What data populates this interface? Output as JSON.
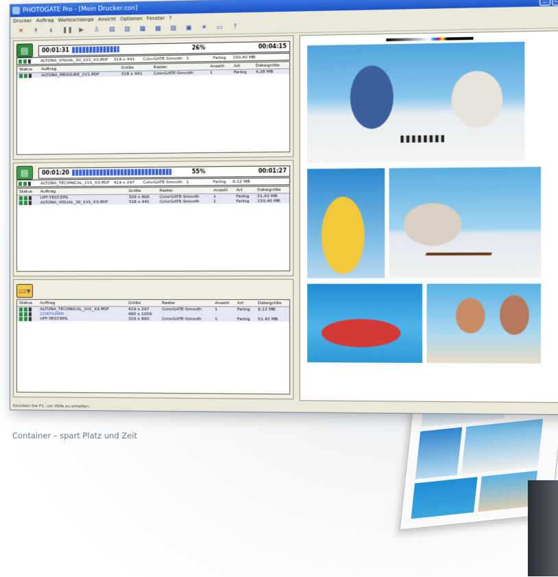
{
  "window": {
    "title": "PHOTOGATE Pro - [Mein Drucker.con]",
    "menu": [
      "Drucker",
      "Auftrag",
      "Warteschlange",
      "Ansicht",
      "Optionen",
      "Fenster",
      "?"
    ]
  },
  "toolbar": {
    "icons": [
      "delete-icon",
      "move-up-icon",
      "move-down-icon",
      "pause-icon",
      "play-icon",
      "print-icon",
      "job-settings-icon",
      "queue-icon",
      "copy-icon",
      "layout-icon",
      "container-icon",
      "preview-icon",
      "crop-icon",
      "save-icon",
      "help-icon"
    ]
  },
  "active_queue": {
    "elapsed": "00:01:31",
    "percent": "26%",
    "progress": 0.26,
    "remaining": "00:04:15",
    "current_job": {
      "name": "ALTONA_VISUAL_30_1V1_X3.PDF",
      "size": "318 x 441",
      "raster": "ColorGATE-Smooth",
      "count": "1",
      "type": "Farbig",
      "filesize": "150,40 MB"
    },
    "columns": [
      "Status",
      "Auftrag",
      "Größe",
      "Raster",
      "Anzahl",
      "Art",
      "Dateigröße"
    ],
    "rows": [
      {
        "job": "ALTONA_MEASURE_1V1.PDF",
        "size": "318 x 441",
        "raster": "ColorGATE-Smooth",
        "count": "1",
        "type": "Farbig",
        "filesize": "4,28 MB"
      }
    ]
  },
  "waiting_queue": {
    "elapsed": "00:01:20",
    "percent": "55%",
    "progress": 0.55,
    "remaining": "00:01:27",
    "current_job": {
      "name": "ALTONA_TECHNICAL_1V1_X3.PDF",
      "size": "419 x 297",
      "raster": "ColorGATE-Smooth",
      "count": "1",
      "type": "Farbig",
      "filesize": "6,12 MB"
    },
    "columns": [
      "Status",
      "Auftrag",
      "Größe",
      "Raster",
      "Anzahl",
      "Art",
      "Dateigröße"
    ],
    "rows": [
      {
        "job": "UFF-TEST.EPS",
        "size": "329 x 800",
        "raster": "ColorGATE-Smooth",
        "count": "1",
        "type": "Farbig",
        "filesize": "51,42 MB"
      },
      {
        "job": "ALTONA_VISUAL_30_1V1_X3.PDF",
        "size": "318 x 441",
        "raster": "ColorGATE-Smooth",
        "count": "1",
        "type": "Farbig",
        "filesize": "150,40 MB"
      }
    ]
  },
  "hold_queue": {
    "columns": [
      "Status",
      "Auftrag",
      "Größe",
      "Raster",
      "Anzahl",
      "Art",
      "Dateigröße"
    ],
    "rows": [
      {
        "job": "ALTONA_TECHNICAL_1V1_X3.PDF",
        "size": "419 x 297",
        "raster": "ColorGATE-Smooth",
        "count": "1",
        "type": "Farbig",
        "filesize": "6,12 MB",
        "style": "normal"
      },
      {
        "job": "CONTAINER",
        "size": "460 x 1056",
        "raster": "",
        "count": "",
        "type": "",
        "filesize": "",
        "style": "blue"
      },
      {
        "job": "UFF-TEST.EPS",
        "size": "329 x 800",
        "raster": "ColorGATE-Smooth",
        "count": "1",
        "type": "Farbig",
        "filesize": "51,42 MB",
        "style": "normal"
      }
    ]
  },
  "statusbar": "Drücken Sie F1, um Hilfe zu erhalten.",
  "caption": "Container – spart Platz und Zeit"
}
